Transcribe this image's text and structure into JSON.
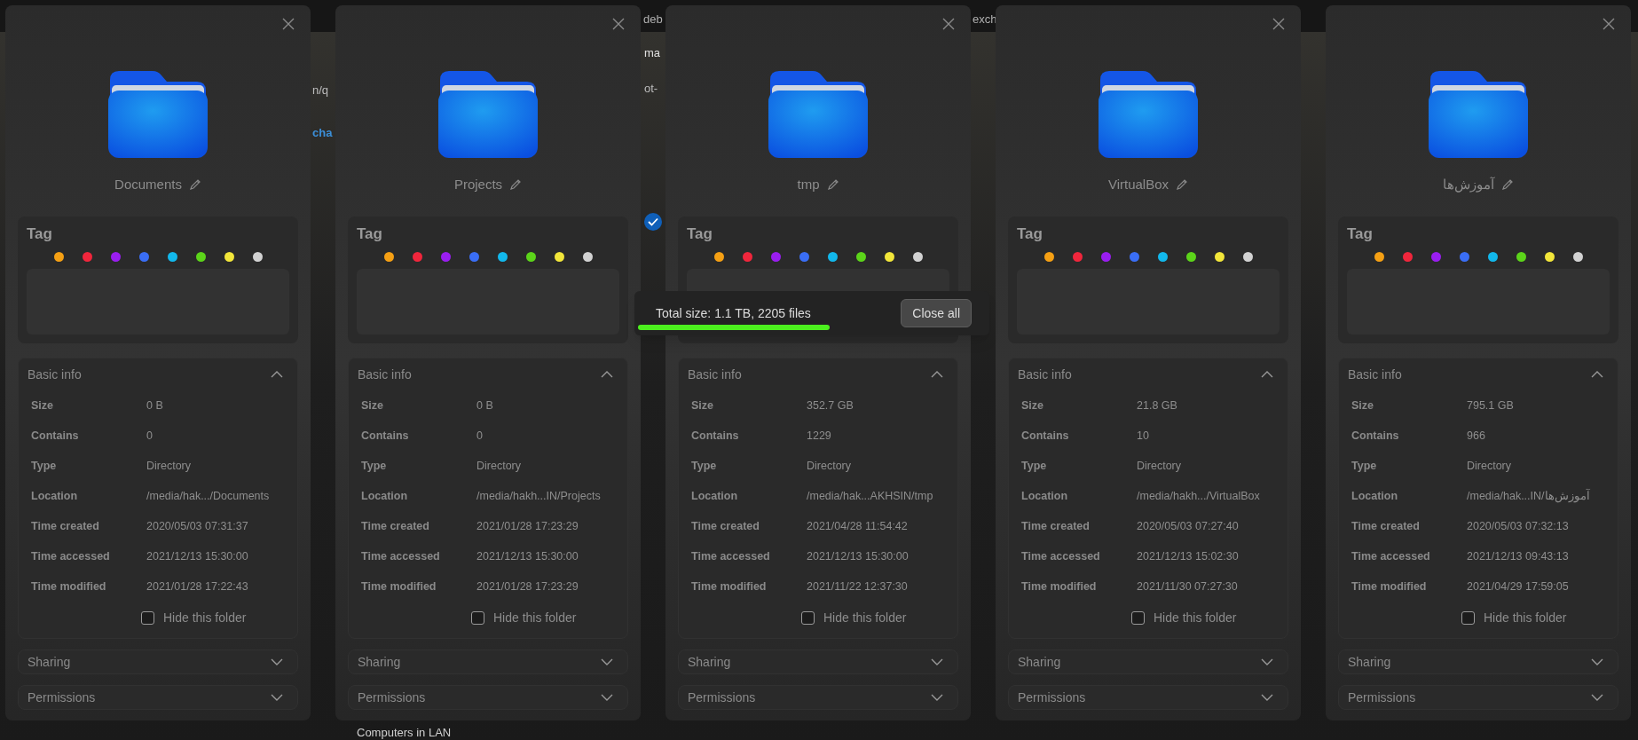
{
  "background": {
    "fragments": [
      "deb",
      "exch",
      "ma",
      "ot-",
      "n/q",
      "cha",
      "Computers in LAN"
    ]
  },
  "panels": [
    {
      "name": "Documents",
      "tag_title": "Tag",
      "tags": [
        {
          "color": "#f5a014"
        },
        {
          "color": "#f0263c"
        },
        {
          "color": "#9a1ef0"
        },
        {
          "color": "#3a6ef5"
        },
        {
          "color": "#12b8ec"
        },
        {
          "color": "#5cd41a"
        },
        {
          "color": "#f2e63a"
        },
        {
          "color": "#d2d2d2"
        }
      ],
      "basic_info": {
        "title": "Basic info",
        "expanded": true,
        "rows": [
          {
            "label": "Size",
            "value": "0 B"
          },
          {
            "label": "Contains",
            "value": "0"
          },
          {
            "label": "Type",
            "value": "Directory"
          },
          {
            "label": "Location",
            "value": "/media/hak.../Documents"
          },
          {
            "label": "Time created",
            "value": "2020/05/03 07:31:37"
          },
          {
            "label": "Time accessed",
            "value": "2021/12/13 15:30:00"
          },
          {
            "label": "Time modified",
            "value": "2021/01/28 17:22:43"
          }
        ],
        "hide": {
          "label": "Hide this folder",
          "checked": false
        }
      },
      "sections": [
        {
          "title": "Sharing",
          "expanded": false
        },
        {
          "title": "Permissions",
          "expanded": false
        }
      ]
    },
    {
      "name": "Projects",
      "tag_title": "Tag",
      "tags": [
        {
          "color": "#f5a014"
        },
        {
          "color": "#f0263c"
        },
        {
          "color": "#9a1ef0"
        },
        {
          "color": "#3a6ef5"
        },
        {
          "color": "#12b8ec"
        },
        {
          "color": "#5cd41a"
        },
        {
          "color": "#f2e63a"
        },
        {
          "color": "#d2d2d2"
        }
      ],
      "basic_info": {
        "title": "Basic info",
        "expanded": true,
        "rows": [
          {
            "label": "Size",
            "value": "0 B"
          },
          {
            "label": "Contains",
            "value": "0"
          },
          {
            "label": "Type",
            "value": "Directory"
          },
          {
            "label": "Location",
            "value": "/media/hakh...IN/Projects"
          },
          {
            "label": "Time created",
            "value": "2021/01/28 17:23:29"
          },
          {
            "label": "Time accessed",
            "value": "2021/12/13 15:30:00"
          },
          {
            "label": "Time modified",
            "value": "2021/01/28 17:23:29"
          }
        ],
        "hide": {
          "label": "Hide this folder",
          "checked": false
        }
      },
      "sections": [
        {
          "title": "Sharing",
          "expanded": false
        },
        {
          "title": "Permissions",
          "expanded": false
        }
      ]
    },
    {
      "name": "tmp",
      "tag_title": "Tag",
      "tags": [
        {
          "color": "#f5a014"
        },
        {
          "color": "#f0263c"
        },
        {
          "color": "#9a1ef0"
        },
        {
          "color": "#3a6ef5"
        },
        {
          "color": "#12b8ec"
        },
        {
          "color": "#5cd41a"
        },
        {
          "color": "#f2e63a"
        },
        {
          "color": "#d2d2d2"
        }
      ],
      "basic_info": {
        "title": "Basic info",
        "expanded": true,
        "rows": [
          {
            "label": "Size",
            "value": "352.7 GB"
          },
          {
            "label": "Contains",
            "value": "1229"
          },
          {
            "label": "Type",
            "value": "Directory"
          },
          {
            "label": "Location",
            "value": "/media/hak...AKHSIN/tmp"
          },
          {
            "label": "Time created",
            "value": "2021/04/28 11:54:42"
          },
          {
            "label": "Time accessed",
            "value": "2021/12/13 15:30:00"
          },
          {
            "label": "Time modified",
            "value": "2021/11/22 12:37:30"
          }
        ],
        "hide": {
          "label": "Hide this folder",
          "checked": false
        }
      },
      "sections": [
        {
          "title": "Sharing",
          "expanded": false
        },
        {
          "title": "Permissions",
          "expanded": false
        }
      ]
    },
    {
      "name": "VirtualBox",
      "tag_title": "Tag",
      "tags": [
        {
          "color": "#f5a014"
        },
        {
          "color": "#f0263c"
        },
        {
          "color": "#9a1ef0"
        },
        {
          "color": "#3a6ef5"
        },
        {
          "color": "#12b8ec"
        },
        {
          "color": "#5cd41a"
        },
        {
          "color": "#f2e63a"
        },
        {
          "color": "#d2d2d2"
        }
      ],
      "basic_info": {
        "title": "Basic info",
        "expanded": true,
        "rows": [
          {
            "label": "Size",
            "value": "21.8 GB"
          },
          {
            "label": "Contains",
            "value": "10"
          },
          {
            "label": "Type",
            "value": "Directory"
          },
          {
            "label": "Location",
            "value": "/media/hakh.../VirtualBox"
          },
          {
            "label": "Time created",
            "value": "2020/05/03 07:27:40"
          },
          {
            "label": "Time accessed",
            "value": "2021/12/13 15:02:30"
          },
          {
            "label": "Time modified",
            "value": "2021/11/30 07:27:30"
          }
        ],
        "hide": {
          "label": "Hide this folder",
          "checked": false
        }
      },
      "sections": [
        {
          "title": "Sharing",
          "expanded": false
        },
        {
          "title": "Permissions",
          "expanded": false
        }
      ]
    },
    {
      "name": "آموزش‌ها",
      "tag_title": "Tag",
      "tags": [
        {
          "color": "#f5a014"
        },
        {
          "color": "#f0263c"
        },
        {
          "color": "#9a1ef0"
        },
        {
          "color": "#3a6ef5"
        },
        {
          "color": "#12b8ec"
        },
        {
          "color": "#5cd41a"
        },
        {
          "color": "#f2e63a"
        },
        {
          "color": "#d2d2d2"
        }
      ],
      "basic_info": {
        "title": "Basic info",
        "expanded": true,
        "rows": [
          {
            "label": "Size",
            "value": "795.1 GB"
          },
          {
            "label": "Contains",
            "value": "966"
          },
          {
            "label": "Type",
            "value": "Directory"
          },
          {
            "label": "Location",
            "value": "/media/hak...IN/آموزش‌ها"
          },
          {
            "label": "Time created",
            "value": "2020/05/03 07:32:13"
          },
          {
            "label": "Time accessed",
            "value": "2021/12/13 09:43:13"
          },
          {
            "label": "Time modified",
            "value": "2021/04/29 17:59:05"
          }
        ],
        "hide": {
          "label": "Hide this folder",
          "checked": false
        }
      },
      "sections": [
        {
          "title": "Sharing",
          "expanded": false
        },
        {
          "title": "Permissions",
          "expanded": false
        }
      ]
    }
  ],
  "summary": {
    "text": "Total size: 1.1 TB, 2205 files",
    "level": 0.55,
    "button": "Close all"
  }
}
